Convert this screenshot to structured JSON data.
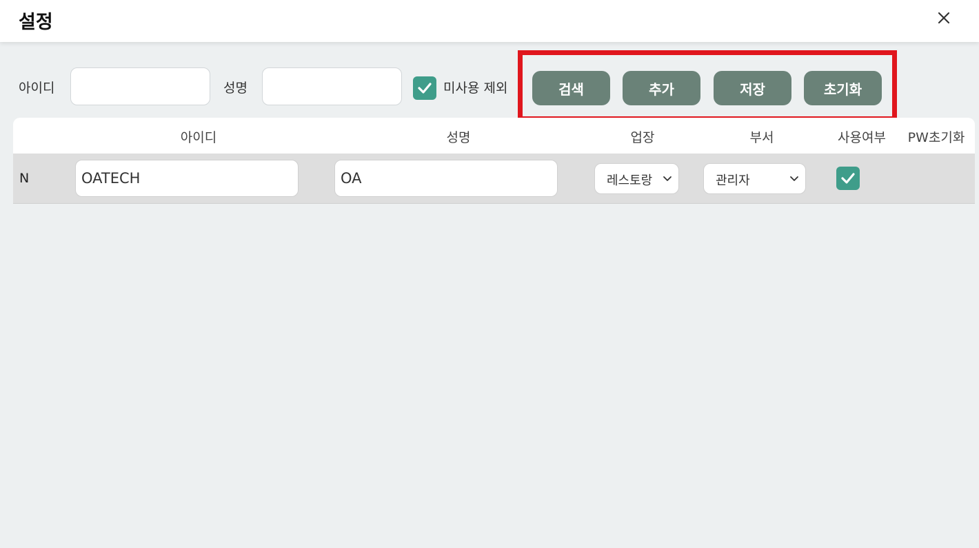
{
  "header": {
    "title": "설정"
  },
  "filter": {
    "id_label": "아이디",
    "id_value": "",
    "name_label": "성명",
    "name_value": "",
    "exclude_unused_label": "미사용 제외",
    "exclude_unused_checked": true
  },
  "toolbar": {
    "search_label": "검색",
    "add_label": "추가",
    "save_label": "저장",
    "reset_label": "초기화"
  },
  "table": {
    "columns": [
      "아이디",
      "성명",
      "업장",
      "부서",
      "사용여부",
      "PW초기화"
    ],
    "rows": [
      {
        "flag": "N",
        "id": "OATECH",
        "name": "OA",
        "workplace": "레스토랑",
        "department": "관리자",
        "in_use": true
      }
    ]
  },
  "colors": {
    "accent": "#3f9d8a",
    "button": "#6a8278",
    "highlight": "#e0161d"
  }
}
